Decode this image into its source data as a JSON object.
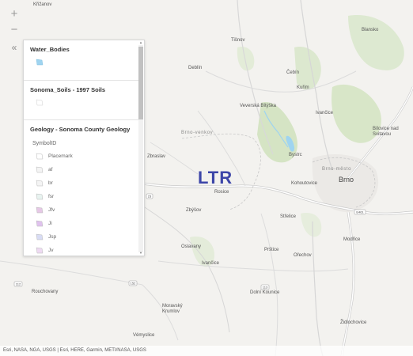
{
  "map": {
    "overlay_label": "LTR",
    "places": {
      "krizanov": "Křižanov",
      "tisnov": "Tišnov",
      "deblin": "Deblín",
      "cebin": "Čebín",
      "kurim": "Kuřim",
      "blansko": "Blansko",
      "veverska_bityska": "Veverská Bítýška",
      "ivancice_north": "Ivančice",
      "brno_venkov": "Brno-venkov",
      "zbraslav": "Zbraslav",
      "bystrc": "Bystrc",
      "brno_mesto": "Brno-město",
      "brno": "Brno",
      "bilovice": "Bílovice nad Svitavou",
      "kohoutovice": "Kohoutovice",
      "rosice": "Rosice",
      "zbysov": "Zbýšov",
      "strelice": "Střelice",
      "modrice": "Modřice",
      "oslavany": "Oslavany",
      "prstice": "Prštice",
      "orechov": "Ořechov",
      "ivancice": "Ivančice",
      "dolni_kounice": "Dolní Kounice",
      "rouchovany": "Rouchovany",
      "moravsky_krumlov": "Moravský Krumlov",
      "zidlochovice": "Židlochovice",
      "vamyslice": "Vémyslice"
    },
    "road_shields": {
      "e461": "E461",
      "r23": "23",
      "r152": "152",
      "r113": "113",
      "r112": "112"
    },
    "colors": {
      "water": "#9fd4f0",
      "forest": "#d3e3c2",
      "highway": "#ffffff",
      "overlay_text": "#3c45a8"
    }
  },
  "controls": {
    "zoom_in": "+",
    "zoom_out": "−",
    "collapse": "«"
  },
  "legend": {
    "layers": [
      {
        "title": "Water_Bodies",
        "symbols": [
          {
            "label": "",
            "color": "#9fd4f0"
          }
        ]
      },
      {
        "title": "Sonoma_Soils - 1997 Soils",
        "symbols": [
          {
            "label": "",
            "color": "#ffffff"
          }
        ]
      },
      {
        "title": "Geology - Sonoma County Geology",
        "field_header": "SymbolID",
        "symbols": [
          {
            "label": "Placemark",
            "color": "#ffffff"
          },
          {
            "label": "af",
            "color": "#f4f4f4"
          },
          {
            "label": "br",
            "color": "#f4f4f4"
          },
          {
            "label": "fsr",
            "color": "#e8f3f0"
          },
          {
            "label": "Jfv",
            "color": "#e6c8e6"
          },
          {
            "label": "Ji",
            "color": "#e0c2ee"
          },
          {
            "label": "Jsp",
            "color": "#d8dcf4"
          },
          {
            "label": "Jv",
            "color": "#eedaf2"
          }
        ]
      }
    ]
  },
  "attribution": "Esri, NASA, NGA, USGS | Esri, HERE, Garmin, METI/NASA, USGS"
}
